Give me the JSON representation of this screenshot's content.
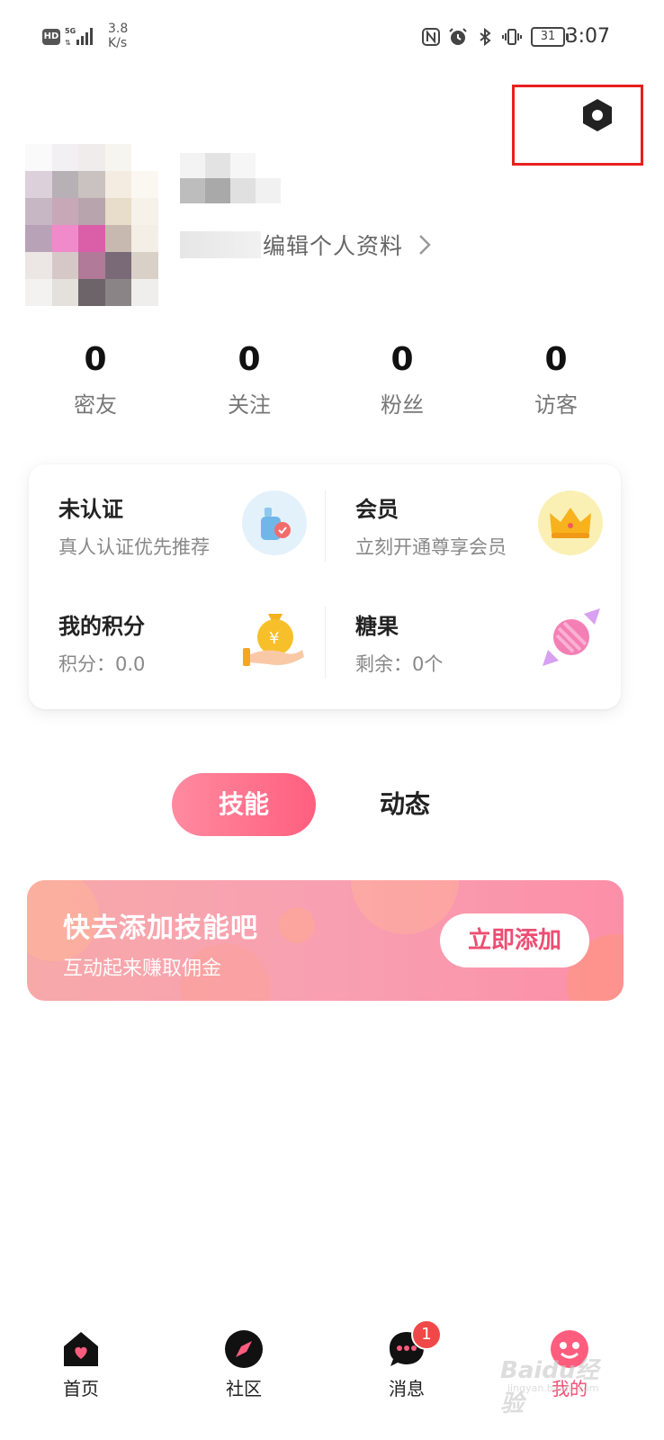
{
  "status_bar": {
    "hd": "HD",
    "network": "5G",
    "speed": "3.8 K/s",
    "battery": "31",
    "time": "3:07"
  },
  "profile": {
    "edit_label": "编辑个人资料"
  },
  "stats": [
    {
      "value": "0",
      "label": "密友"
    },
    {
      "value": "0",
      "label": "关注"
    },
    {
      "value": "0",
      "label": "粉丝"
    },
    {
      "value": "0",
      "label": "访客"
    }
  ],
  "card": {
    "verify": {
      "title": "未认证",
      "subtitle": "真人认证优先推荐"
    },
    "member": {
      "title": "会员",
      "subtitle": "立刻开通尊享会员"
    },
    "points": {
      "title": "我的积分",
      "subtitle": "积分：0.0"
    },
    "candy": {
      "title": "糖果",
      "subtitle": "剩余：0个"
    }
  },
  "tabs": {
    "skills": "技能",
    "moments": "动态"
  },
  "banner": {
    "title": "快去添加技能吧",
    "subtitle": "互动起来赚取佣金",
    "button": "立即添加"
  },
  "bottom_nav": {
    "home": "首页",
    "community": "社区",
    "messages": "消息",
    "messages_badge": "1",
    "mine": "我的"
  },
  "watermark": {
    "text": "Baidu经验",
    "sub": "jingyan.baidu.com"
  },
  "colors": {
    "accent": "#ee4d72",
    "highlight_box": "#e8201e",
    "badge": "#f04848"
  },
  "icons": [
    "settings-icon",
    "chevron-right-icon",
    "verify-icon",
    "crown-icon",
    "money-bag-icon",
    "candy-icon",
    "home-icon",
    "compass-icon",
    "chat-icon",
    "profile-icon"
  ]
}
